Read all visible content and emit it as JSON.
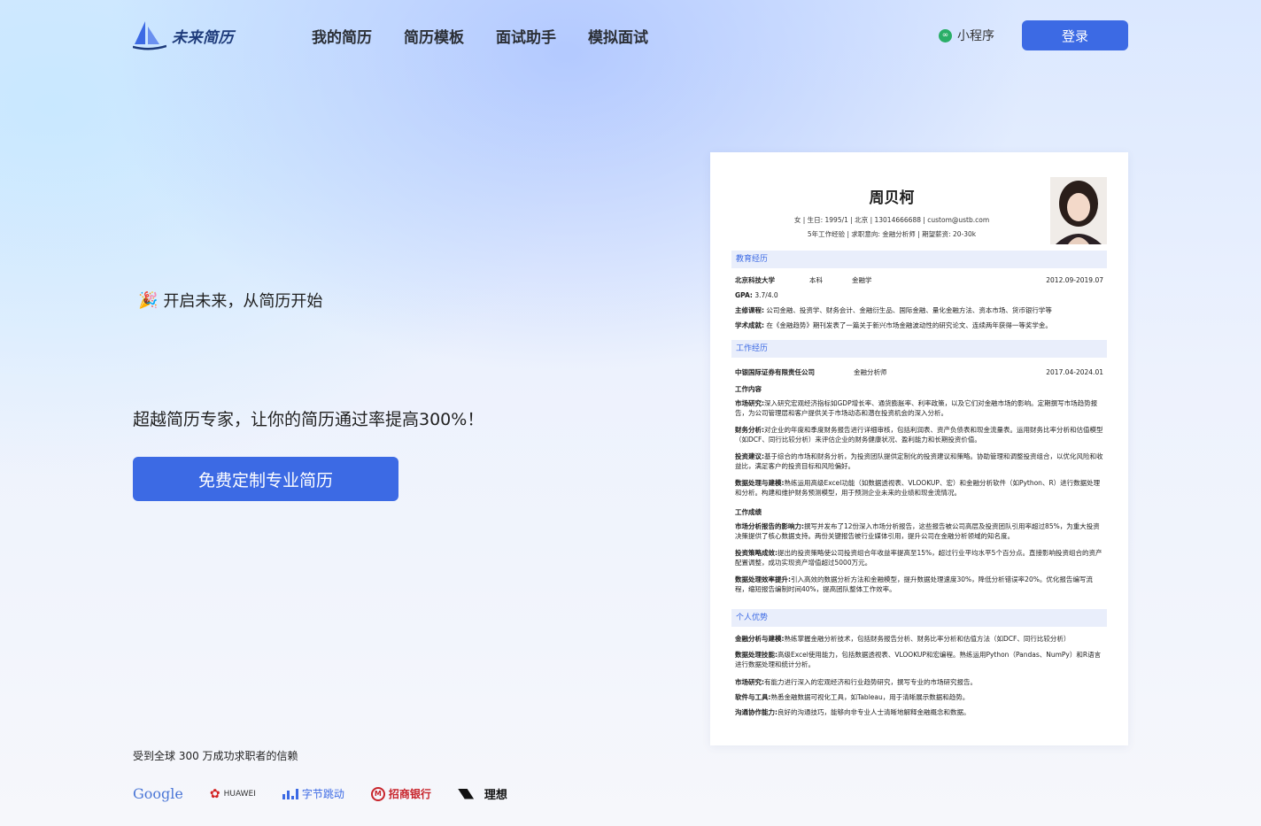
{
  "brand": {
    "name": "未来简历"
  },
  "nav": {
    "links": [
      "我的简历",
      "简历模板",
      "面试助手",
      "模拟面试"
    ],
    "mini_program": "小程序",
    "login": "登录"
  },
  "hero": {
    "tagline": "开启未来，从简历开始",
    "headline": "超越简历专家，让你的简历通过率提高300%！",
    "cta": "免费定制专业简历",
    "trust": "受到全球 300 万成功求职者的信赖",
    "brands": [
      "Google",
      "HUAWEI",
      "ByteDance",
      "字节跳动",
      "招商银行",
      "CHINA MERCHANTS BANK",
      "理想"
    ]
  },
  "resume": {
    "name": "周贝柯",
    "basic": "女 | 生日: 1995/1 | 北京 | 13014666688 | custom@ustb.com",
    "target": "5年工作经验 | 求职意向: 金融分析师 | 期望薪资: 20-30k",
    "education": {
      "title": "教育经历",
      "school": "北京科技大学",
      "degree": "本科",
      "major": "金融学",
      "period": "2012.09-2019.07",
      "gpa_label": "GPA:",
      "gpa": "3.7/4.0",
      "courses_label": "主修课程:",
      "courses": "公司金融、投资学、财务会计、金融衍生品、国际金融、量化金融方法、资本市场、货币银行学等",
      "honors_label": "学术成就:",
      "honors": "在《金融趋势》期刊发表了一篇关于新兴市场金融波动性的研究论文、连续两年获得一等奖学金。"
    },
    "work": {
      "title": "工作经历",
      "company": "中银国际证券有限责任公司",
      "role": "金融分析师",
      "period": "2017.04-2024.01",
      "content_label": "工作内容",
      "items": [
        {
          "label": "市场研究:",
          "text": "深入研究宏观经济指标如GDP增长率、通货膨胀率、利率政策，以及它们对金融市场的影响。定期撰写市场趋势报告，为公司管理层和客户提供关于市场动态和潜在投资机会的深入分析。"
        },
        {
          "label": "财务分析:",
          "text": "对企业的年度和季度财务报告进行详细审核，包括利润表、资产负债表和现金流量表。运用财务比率分析和估值模型（如DCF、同行比较分析）来评估企业的财务健康状况、盈利能力和长期投资价值。"
        },
        {
          "label": "投资建议:",
          "text": "基于综合的市场和财务分析，为投资团队提供定制化的投资建议和策略。协助管理和调整投资组合，以优化风险和收益比，满足客户的投资目标和风险偏好。"
        },
        {
          "label": "数据处理与建模:",
          "text": "熟练运用高级Excel功能（如数据透视表、VLOOKUP、宏）和金融分析软件（如Python、R）进行数据处理和分析。构建和维护财务预测模型，用于预测企业未来的业绩和现金流情况。"
        }
      ],
      "results_label": "工作成绩",
      "results": [
        {
          "label": "市场分析报告的影响力:",
          "text": "撰写并发布了12份深入市场分析报告，这些报告被公司高层及投资团队引用率超过85%，为重大投资决策提供了核心数据支持。两份关键报告被行业媒体引用，提升公司在金融分析领域的知名度。"
        },
        {
          "label": "投资策略成效:",
          "text": "提出的投资策略使公司投资组合年收益率提高至15%，超过行业平均水平5个百分点。直接影响投资组合的资产配置调整，成功实现资产增值超过5000万元。"
        },
        {
          "label": "数据处理效率提升:",
          "text": "引入高效的数据分析方法和金融模型，提升数据处理速度30%，降低分析错误率20%。优化报告编写流程，缩短报告编制时间40%，提高团队整体工作效率。"
        }
      ]
    },
    "strengths": {
      "title": "个人优势",
      "items": [
        {
          "label": "金融分析与建模:",
          "text": "熟练掌握金融分析技术，包括财务报告分析、财务比率分析和估值方法（如DCF、同行比较分析）"
        },
        {
          "label": "数据处理技能:",
          "text": "高级Excel使用能力，包括数据透视表、VLOOKUP和宏编程。熟练运用Python（Pandas、NumPy）和R语言进行数据处理和统计分析。"
        },
        {
          "label": "市场研究:",
          "text": "有能力进行深入的宏观经济和行业趋势研究，撰写专业的市场研究报告。"
        },
        {
          "label": "软件与工具:",
          "text": "熟悉金融数据可视化工具，如Tableau，用于清晰展示数据和趋势。"
        },
        {
          "label": "沟通协作能力:",
          "text": "良好的沟通技巧，能够向非专业人士清晰地解释金融概念和数据。"
        }
      ]
    }
  }
}
